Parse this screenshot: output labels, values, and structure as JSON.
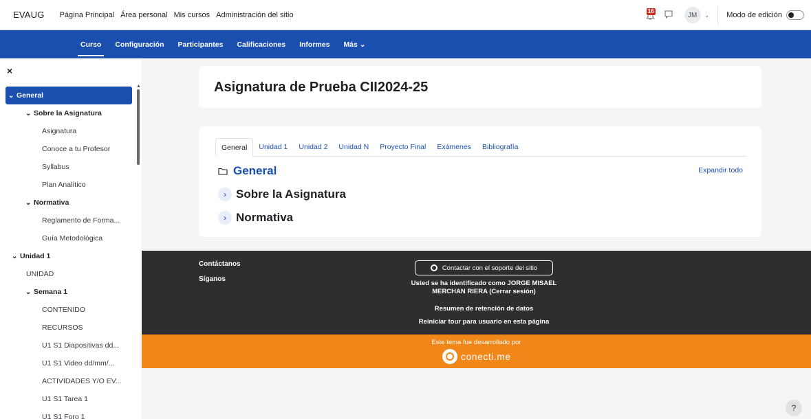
{
  "topbar": {
    "brand": "EVAUG",
    "nav": [
      "Página Principal",
      "Área personal",
      "Mis cursos",
      "Administración del sitio"
    ],
    "notification_count": "16",
    "avatar_initials": "JM",
    "edit_mode_label": "Modo de edición",
    "edit_mode_on": false
  },
  "secondary_nav": {
    "items": [
      "Curso",
      "Configuración",
      "Participantes",
      "Calificaciones",
      "Informes",
      "Más ⌄"
    ],
    "active": "Curso"
  },
  "sidebar": {
    "close_label": "×",
    "items": [
      {
        "label": "General",
        "caret": "⌄",
        "selected": true
      },
      {
        "label": "Sobre la Asignatura",
        "caret": "⌄"
      },
      {
        "label": "Asignatura"
      },
      {
        "label": "Conoce a tu Profesor"
      },
      {
        "label": "Syllabus"
      },
      {
        "label": "Plan Analítico"
      },
      {
        "label": "Normativa",
        "caret": "⌄"
      },
      {
        "label": "Reglamento de Forma..."
      },
      {
        "label": "Guía Metodológica"
      },
      {
        "label": "Unidad 1",
        "caret": "⌄"
      },
      {
        "label": "UNIDAD"
      },
      {
        "label": "Semana 1",
        "caret": "⌄"
      },
      {
        "label": "CONTENIDO"
      },
      {
        "label": "RECURSOS"
      },
      {
        "label": "U1 S1 Diapositivas dd..."
      },
      {
        "label": "U1 S1 Video dd/mm/..."
      },
      {
        "label": "ACTIVIDADES Y/O EV..."
      },
      {
        "label": "U1 S1 Tarea 1"
      },
      {
        "label": "U1 S1 Foro 1"
      }
    ]
  },
  "course": {
    "title": "Asignatura de Prueba CII2024-25",
    "tabs": [
      "General",
      "Unidad 1",
      "Unidad 2",
      "Unidad N",
      "Proyecto Final",
      "Exámenes",
      "Bibliografía"
    ],
    "active_tab": "General",
    "section_general": "General",
    "section_sobre": "Sobre la Asignatura",
    "section_normativa": "Normativa",
    "expand_all": "Expandir todo"
  },
  "footer": {
    "contact": "Contáctanos",
    "follow": "Síganos",
    "support_button": "Contactar con el soporte del sitio",
    "identity_line1": "Usted se ha identificado como JORGE MISAEL",
    "identity_line2": "MERCHAN RIERA (Cerrar sesión)",
    "retention": "Resumen de retención de datos",
    "tour": "Reiniciar tour para usuario en esta página",
    "developed_by": "Este tema fue desarrollado por",
    "developer_logo_text": "conecti.me"
  },
  "help_label": "?",
  "colors": {
    "primary": "#1a4fb0",
    "footer_dark": "#2e2e2e",
    "brand_orange": "#f18619",
    "badge_red": "#ca3120"
  }
}
